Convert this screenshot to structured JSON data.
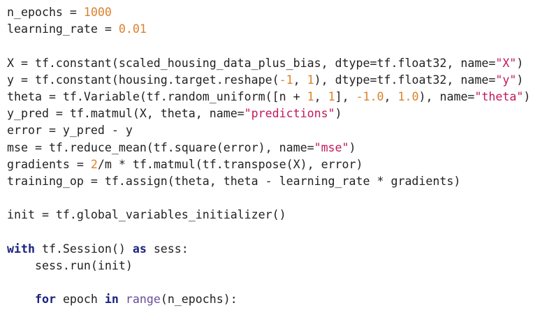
{
  "colors": {
    "plain": "#222222",
    "number": "#d9822b",
    "string": "#c2185b",
    "keyword": "#1a237e",
    "builtin": "#6a4c9c",
    "background": "#ffffff"
  },
  "code": {
    "language": "python",
    "lines": [
      [
        {
          "t": "plain",
          "v": "n_epochs = "
        },
        {
          "t": "num",
          "v": "1000"
        }
      ],
      [
        {
          "t": "plain",
          "v": "learning_rate = "
        },
        {
          "t": "num",
          "v": "0.01"
        }
      ],
      [],
      [
        {
          "t": "plain",
          "v": "X = tf.constant(scaled_housing_data_plus_bias, dtype=tf.float32, name="
        },
        {
          "t": "str",
          "v": "\"X\""
        },
        {
          "t": "plain",
          "v": ")"
        }
      ],
      [
        {
          "t": "plain",
          "v": "y = tf.constant(housing.target.reshape("
        },
        {
          "t": "num",
          "v": "-1"
        },
        {
          "t": "plain",
          "v": ", "
        },
        {
          "t": "num",
          "v": "1"
        },
        {
          "t": "plain",
          "v": "), dtype=tf.float32, name="
        },
        {
          "t": "str",
          "v": "\"y\""
        },
        {
          "t": "plain",
          "v": ")"
        }
      ],
      [
        {
          "t": "plain",
          "v": "theta = tf.Variable(tf.random_uniform([n + "
        },
        {
          "t": "num",
          "v": "1"
        },
        {
          "t": "plain",
          "v": ", "
        },
        {
          "t": "num",
          "v": "1"
        },
        {
          "t": "plain",
          "v": "], "
        },
        {
          "t": "num",
          "v": "-1.0"
        },
        {
          "t": "plain",
          "v": ", "
        },
        {
          "t": "num",
          "v": "1.0"
        },
        {
          "t": "plain",
          "v": "), name="
        },
        {
          "t": "str",
          "v": "\"theta\""
        },
        {
          "t": "plain",
          "v": ")"
        }
      ],
      [
        {
          "t": "plain",
          "v": "y_pred = tf.matmul(X, theta, name="
        },
        {
          "t": "str",
          "v": "\"predictions\""
        },
        {
          "t": "plain",
          "v": ")"
        }
      ],
      [
        {
          "t": "plain",
          "v": "error = y_pred - y"
        }
      ],
      [
        {
          "t": "plain",
          "v": "mse = tf.reduce_mean(tf.square(error), name="
        },
        {
          "t": "str",
          "v": "\"mse\""
        },
        {
          "t": "plain",
          "v": ")"
        }
      ],
      [
        {
          "t": "plain",
          "v": "gradients = "
        },
        {
          "t": "num",
          "v": "2"
        },
        {
          "t": "plain",
          "v": "/m * tf.matmul(tf.transpose(X), error)"
        }
      ],
      [
        {
          "t": "plain",
          "v": "training_op = tf.assign(theta, theta - learning_rate * gradients)"
        }
      ],
      [],
      [
        {
          "t": "plain",
          "v": "init = tf.global_variables_initializer()"
        }
      ],
      [],
      [
        {
          "t": "kw",
          "v": "with"
        },
        {
          "t": "plain",
          "v": " tf.Session() "
        },
        {
          "t": "kw",
          "v": "as"
        },
        {
          "t": "plain",
          "v": " sess:"
        }
      ],
      [
        {
          "t": "plain",
          "v": "    sess.run(init)"
        }
      ],
      [],
      [
        {
          "t": "plain",
          "v": "    "
        },
        {
          "t": "kw",
          "v": "for"
        },
        {
          "t": "plain",
          "v": " epoch "
        },
        {
          "t": "kw",
          "v": "in"
        },
        {
          "t": "plain",
          "v": " "
        },
        {
          "t": "builtin",
          "v": "range"
        },
        {
          "t": "plain",
          "v": "(n_epochs):"
        }
      ]
    ]
  }
}
